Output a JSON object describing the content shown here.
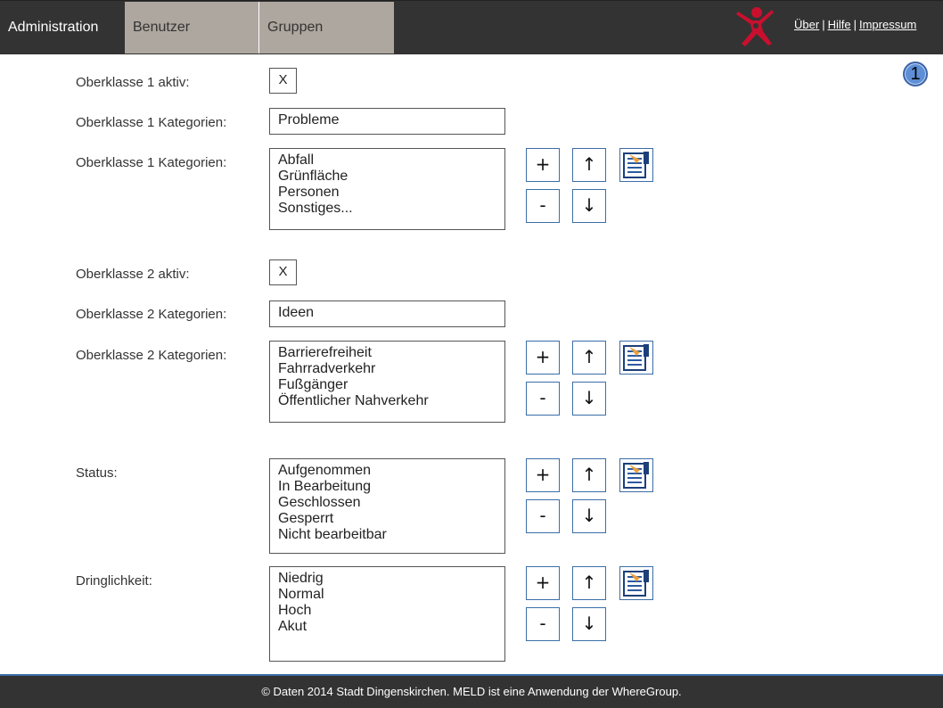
{
  "nav": {
    "admin": "Administration",
    "benutzer": "Benutzer",
    "gruppen": "Gruppen"
  },
  "links": {
    "ueber": "Über",
    "hilfe": "Hilfe",
    "impressum": "Impressum",
    "separator": "|"
  },
  "badge": "1",
  "form": {
    "ok1_aktiv_label": "Oberklasse 1 aktiv:",
    "ok1_aktiv_value": "X",
    "ok1_kat_label": "Oberklasse 1 Kategorien:",
    "ok1_kat_value": "Probleme",
    "ok1_list_label": "Oberklasse 1 Kategorien:",
    "ok1_list": [
      "Abfall",
      "Grünfläche",
      "Personen",
      "Sonstiges..."
    ],
    "ok2_aktiv_label": "Oberklasse 2 aktiv:",
    "ok2_aktiv_value": "X",
    "ok2_kat_label": "Oberklasse 2 Kategorien:",
    "ok2_kat_value": "Ideen",
    "ok2_list_label": "Oberklasse 2 Kategorien:",
    "ok2_list": [
      "Barrierefreiheit",
      "Fahrradverkehr",
      "Fußgänger",
      "Öffentlicher Nahverkehr"
    ],
    "status_label": "Status:",
    "status_list": [
      "Aufgenommen",
      "In Bearbeitung",
      "Geschlossen",
      "Gesperrt",
      "Nicht bearbeitbar"
    ],
    "dringlichkeit_label": "Dringlichkeit:",
    "dringlichkeit_list": [
      "Niedrig",
      "Normal",
      "Hoch",
      "Akut"
    ]
  },
  "buttons": {
    "add": "+",
    "remove": "-",
    "up": "↑",
    "down": "↓"
  },
  "footer": "© Daten 2014 Stadt Dingenskirchen. MELD ist eine Anwendung der WhereGroup.",
  "colors": {
    "topbar": "#333333",
    "tab_bg": "#aea79f",
    "button_border": "#3b6ea8",
    "logo": "#c8102e",
    "badge": "#5e8fd6"
  }
}
